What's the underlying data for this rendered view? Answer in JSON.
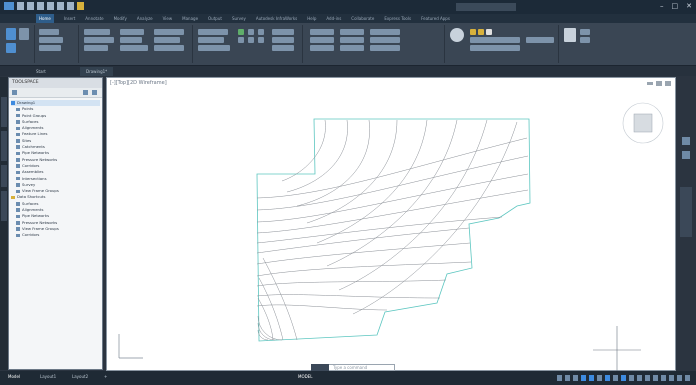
{
  "app": {
    "title": ""
  },
  "quick_access": [
    "new-icon",
    "open-icon",
    "save-icon",
    "undo-icon",
    "redo-icon",
    "print-icon",
    "share-icon"
  ],
  "window_controls": [
    "minimize-icon",
    "maximize-icon",
    "close-icon"
  ],
  "ribbon": {
    "tabs": [
      "Home",
      "Insert",
      "Annotate",
      "Modify",
      "Analyze",
      "View",
      "Manage",
      "Output",
      "Survey",
      "Autodesk InfraWorks",
      "Help",
      "Add-ins",
      "Collaborate",
      "Express Tools",
      "Featured Apps"
    ],
    "active_tab": "Home"
  },
  "doc_tabs": [
    "Start",
    "Drawing1*"
  ],
  "toolspace": {
    "title": "TOOLSPACE",
    "tree": [
      "Drawing1",
      "Points",
      "Point Groups",
      "Surfaces",
      "Alignments",
      "Feature Lines",
      "Sites",
      "Catchments",
      "Pipe Networks",
      "Pressure Networks",
      "Corridors",
      "Assemblies",
      "Intersections",
      "Survey",
      "View Frame Groups",
      "Data Shortcuts",
      "Surfaces",
      "Alignments",
      "Pipe Networks",
      "Pressure Networks",
      "View Frame Groups",
      "Corridors"
    ]
  },
  "viewport": {
    "label": "[-][Top][2D Wireframe]"
  },
  "command_line": {
    "placeholder": "Type a command"
  },
  "status_bar": {
    "tabs": [
      "Model",
      "Layout1",
      "Layout2",
      "+"
    ],
    "active": "Model",
    "model_label": "MODEL"
  },
  "colors": {
    "boundary": "#5cc6c0",
    "contour": "#8a8f96",
    "accent": "#2e5d8a"
  }
}
